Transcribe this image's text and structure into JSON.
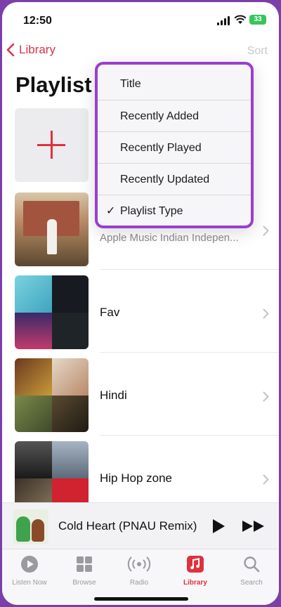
{
  "status_bar": {
    "time": "12:50",
    "battery": "33"
  },
  "nav": {
    "back_label": "Library",
    "sort_label": "Sort",
    "page_title": "Playlist"
  },
  "sort_menu": {
    "items": [
      {
        "label": "Title",
        "checked": false
      },
      {
        "label": "Recently Added",
        "checked": false
      },
      {
        "label": "Recently Played",
        "checked": false
      },
      {
        "label": "Recently Updated",
        "checked": false
      },
      {
        "label": "Playlist Type",
        "checked": true
      }
    ],
    "check_glyph": "✓",
    "highlight_color": "#9b3dd0"
  },
  "playlists": [
    {
      "name": "",
      "subtitle": "Apple Music Indian Indepen..."
    },
    {
      "name": "Fav",
      "subtitle": ""
    },
    {
      "name": "Hindi",
      "subtitle": ""
    },
    {
      "name": "Hip Hop zone",
      "subtitle": ""
    }
  ],
  "now_playing": {
    "title": "Cold Heart (PNAU Remix)"
  },
  "tabs": [
    {
      "label": "Listen Now",
      "icon": "play-circle-icon",
      "active": false
    },
    {
      "label": "Browse",
      "icon": "grid-icon",
      "active": false
    },
    {
      "label": "Radio",
      "icon": "radio-waves-icon",
      "active": false
    },
    {
      "label": "Library",
      "icon": "music-note-icon",
      "active": true
    },
    {
      "label": "Search",
      "icon": "search-icon",
      "active": false
    }
  ],
  "colors": {
    "accent": "#e0303f",
    "battery": "#34c759"
  }
}
